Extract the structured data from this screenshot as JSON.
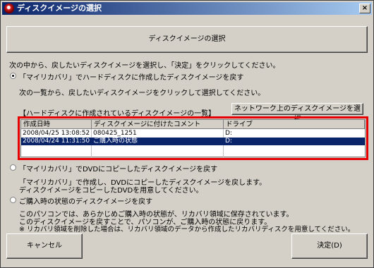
{
  "window": {
    "title": "ディスクイメージの選択",
    "close_glyph": "×"
  },
  "header_button": "ディスクイメージの選択",
  "intro": "次の中から、戻したいディスクイメージを選択し、「決定」をクリックしてください。",
  "option1": {
    "label": "「マイリカバリ」でハードディスクに作成したディスクイメージを戻す",
    "desc": "次の一覧から、戻したいディスクイメージをクリックして選択してください。",
    "selected": true
  },
  "list_section": {
    "caption": "【ハードディスクに作成されているディスクイメージの一覧】",
    "network_button": "ネットワーク上のディスクイメージを選択",
    "columns": [
      "作成日時",
      "ディスクイメージに付けたコメント",
      "ドライブ"
    ],
    "rows": [
      {
        "date": "2008/04/25 13:08:52",
        "comment": "080425_1251",
        "drive": "D:",
        "selected": false
      },
      {
        "date": "2008/04/24 11:31:50",
        "comment": "ご購入時の状態",
        "drive": "D:",
        "selected": true
      }
    ]
  },
  "option2": {
    "label": "「マイリカバリ」でDVDにコピーしたディスクイメージを戻す",
    "desc_lines": [
      "「マイリカバリ」で作成し、DVDにコピーしたディスクイメージを戻します。",
      "ディスクイメージをコピーしたDVDを用意してください。"
    ],
    "selected": false
  },
  "option3": {
    "label": "ご購入時の状態のディスクイメージを戻す",
    "desc_lines": [
      "このパソコンでは、あらかじめご購入時の状態が、リカバリ領域に保存されています。",
      "このディスクイメージを戻すことで、パソコンが、ご購入時の状態に戻ります。",
      "※ リカバリ領域を削除した場合は、リカバリ領域のデータから作成したリカバリディスクを用意してください。"
    ],
    "selected": false
  },
  "footer": {
    "cancel": "キャンセル",
    "ok": "決定(D)"
  }
}
